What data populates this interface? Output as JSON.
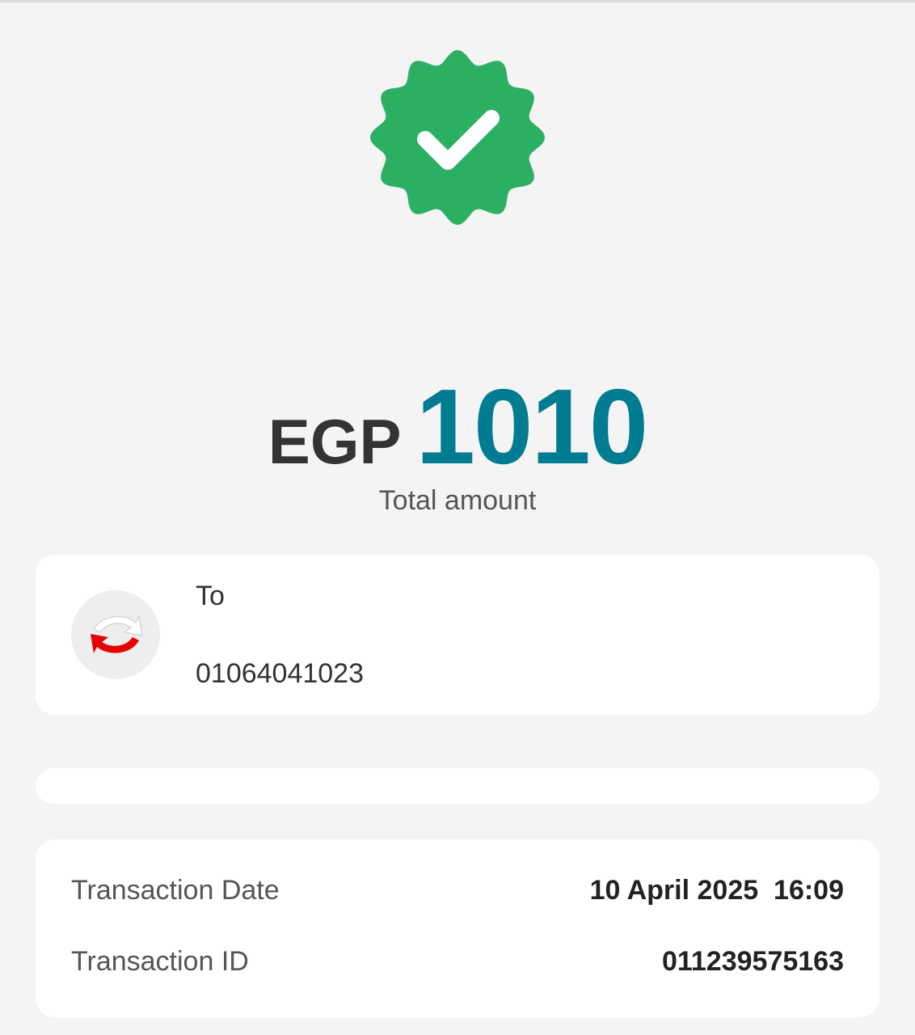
{
  "status": {
    "icon": "verified-check-badge-icon",
    "color": "#2bb063"
  },
  "amount": {
    "currency": "EGP",
    "value": "1010",
    "label": "Total amount",
    "value_color": "#007c92"
  },
  "recipient": {
    "icon": "transfer-arrows-icon",
    "label": "To",
    "number": "01064041023"
  },
  "details": [
    {
      "label": "Transaction Date",
      "value": "10 April 2025  16:09"
    },
    {
      "label": "Transaction ID",
      "value": "011239575163"
    }
  ]
}
